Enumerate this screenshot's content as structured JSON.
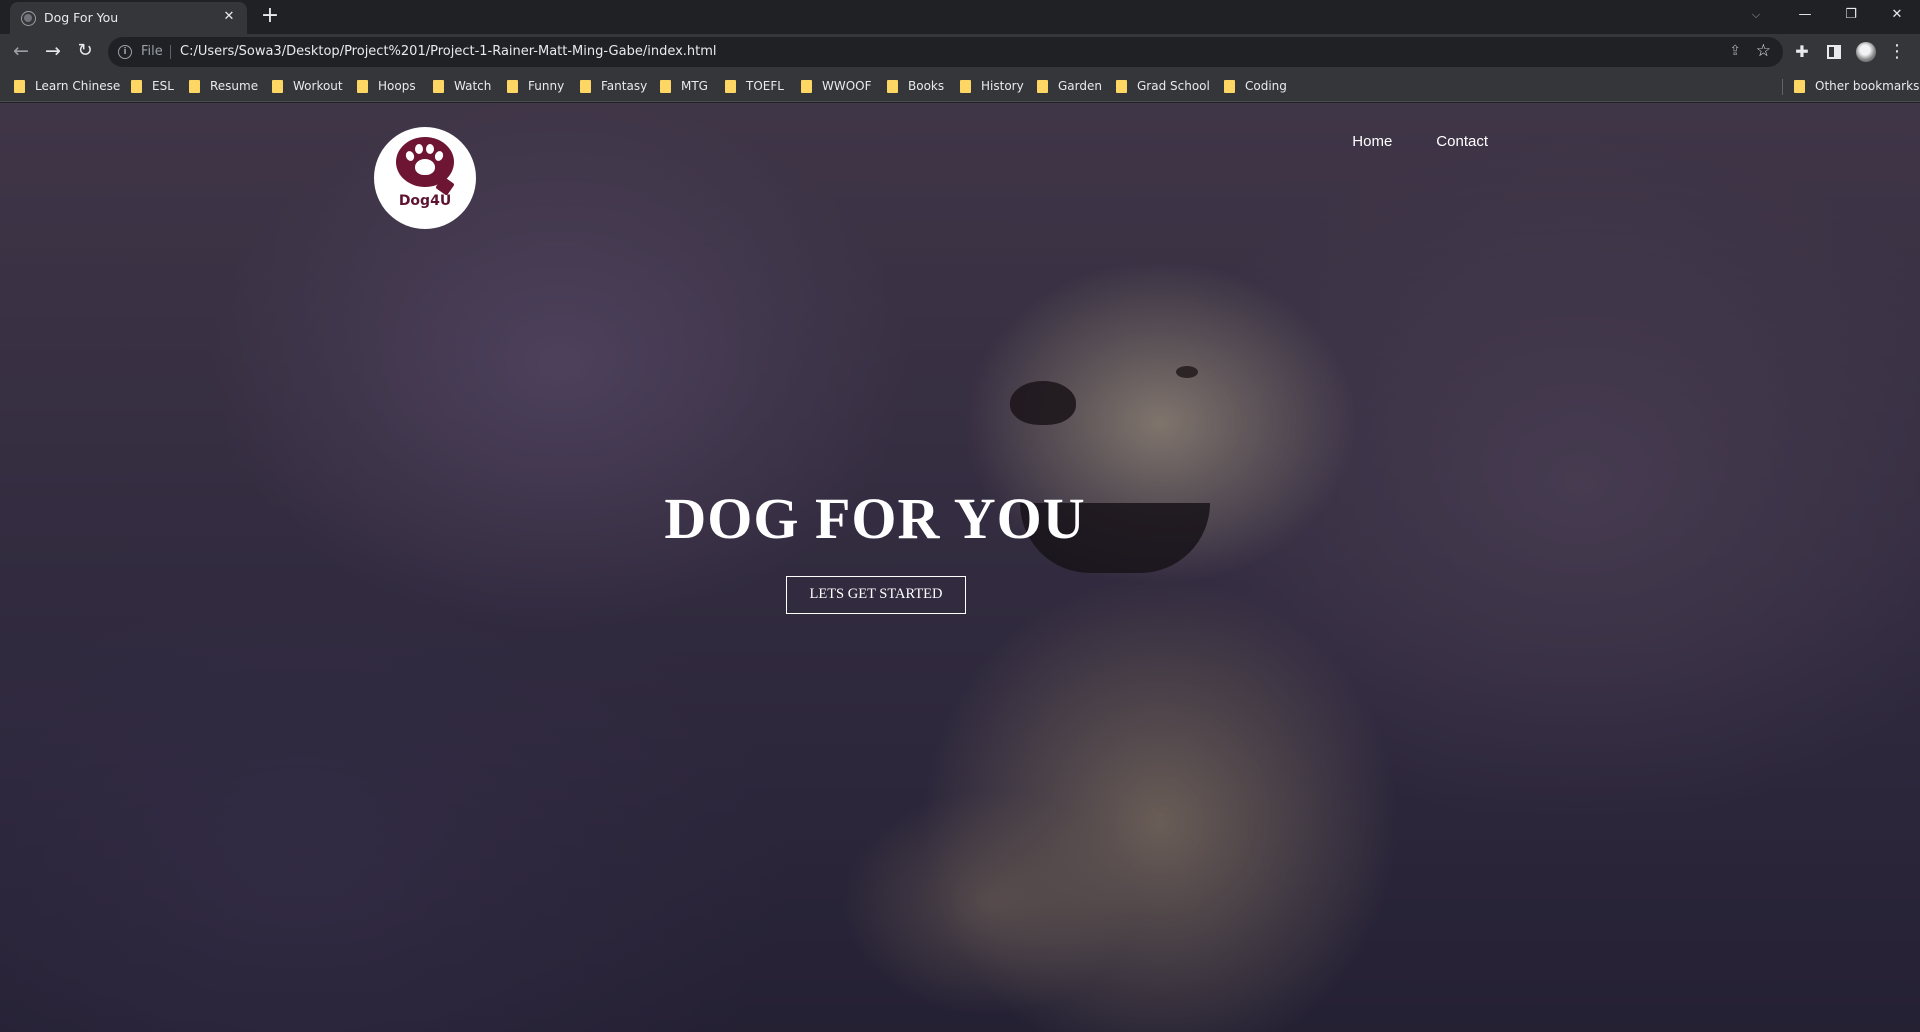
{
  "browser": {
    "tab": {
      "title": "Dog For You"
    },
    "address": {
      "scheme": "File",
      "url": "C:/Users/Sowa3/Desktop/Project%201/Project-1-Rainer-Matt-Ming-Gabe/index.html"
    },
    "bookmarks": [
      "Learn Chinese",
      "ESL",
      "Resume",
      "Workout",
      "Hoops",
      "Watch",
      "Funny",
      "Fantasy",
      "MTG",
      "TOEFL",
      "WWOOF",
      "Books",
      "History",
      "Garden",
      "Grad School",
      "Coding"
    ],
    "other_bookmarks": "Other bookmarks"
  },
  "site": {
    "logo_text": "Dog4U",
    "nav": {
      "home": "Home",
      "contact": "Contact"
    },
    "hero": {
      "title": "DOG FOR YOU",
      "cta": "LETS GET STARTED"
    }
  },
  "colors": {
    "brand": "#6d1533",
    "bookmark_folder": "#fdd663"
  }
}
